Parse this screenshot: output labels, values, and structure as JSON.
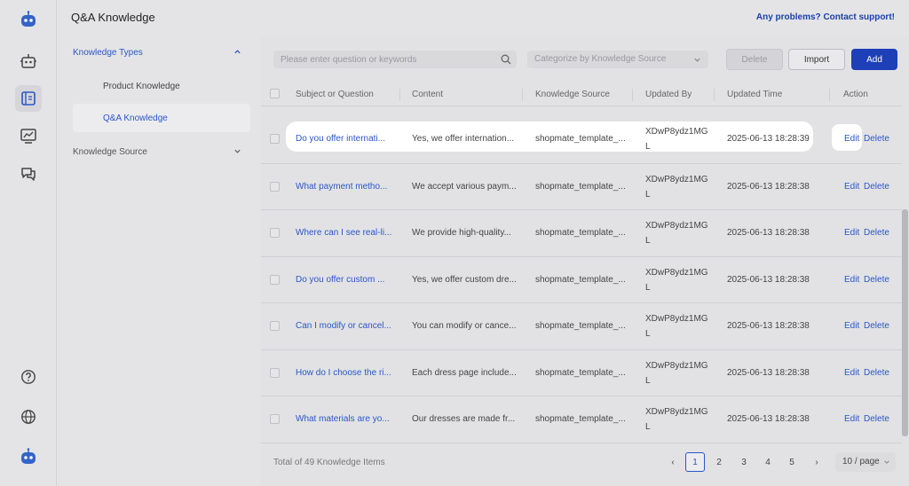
{
  "header": {
    "title": "Q&A Knowledge",
    "support_link": "Any problems? Contact support!"
  },
  "rail": {
    "icons": [
      "robot-logo-icon",
      "bot-icon",
      "knowledge-book-icon",
      "analytics-icon",
      "chat-icon",
      "help-icon",
      "globe-icon",
      "robot-avatar-icon"
    ]
  },
  "nav": {
    "group_types": "Knowledge Types",
    "item_product": "Product Knowledge",
    "item_qa": "Q&A Knowledge",
    "group_source": "Knowledge Source"
  },
  "toolbar": {
    "search_placeholder": "Please enter question or keywords",
    "category_placeholder": "Categorize by Knowledge Source",
    "delete_label": "Delete",
    "import_label": "Import",
    "add_label": "Add"
  },
  "table": {
    "columns": [
      "Subject or Question",
      "Content",
      "Knowledge Source",
      "Updated By",
      "Updated Time",
      "Action"
    ],
    "rows": [
      {
        "subject": "Do you offer internati...",
        "content": "Yes, we offer internation...",
        "source": "shopmate_template_...",
        "updated_by_1": "XDwP8ydz1MG",
        "updated_by_2": "L",
        "time": "2025-06-13 18:28:39",
        "edit": "Edit",
        "delete": "Delete"
      },
      {
        "subject": "What payment metho...",
        "content": "We accept various paym...",
        "source": "shopmate_template_...",
        "updated_by_1": "XDwP8ydz1MG",
        "updated_by_2": "L",
        "time": "2025-06-13 18:28:38",
        "edit": "Edit",
        "delete": "Delete"
      },
      {
        "subject": "Where can I see real-li...",
        "content": "We provide high-quality...",
        "source": "shopmate_template_...",
        "updated_by_1": "XDwP8ydz1MG",
        "updated_by_2": "L",
        "time": "2025-06-13 18:28:38",
        "edit": "Edit",
        "delete": "Delete"
      },
      {
        "subject": " Do you offer custom ...",
        "content": "Yes, we offer custom dre...",
        "source": "shopmate_template_...",
        "updated_by_1": "XDwP8ydz1MG",
        "updated_by_2": "L",
        "time": "2025-06-13 18:28:38",
        "edit": "Edit",
        "delete": "Delete"
      },
      {
        "subject": "Can I modify or cancel...",
        "content": "You can modify or cance...",
        "source": "shopmate_template_...",
        "updated_by_1": "XDwP8ydz1MG",
        "updated_by_2": "L",
        "time": "2025-06-13 18:28:38",
        "edit": "Edit",
        "delete": "Delete"
      },
      {
        "subject": "How do I choose the ri...",
        "content": "Each dress page include...",
        "source": "shopmate_template_...",
        "updated_by_1": "XDwP8ydz1MG",
        "updated_by_2": "L",
        "time": "2025-06-13 18:28:38",
        "edit": "Edit",
        "delete": "Delete"
      },
      {
        "subject": "What materials are yo...",
        "content": "Our dresses are made fr...",
        "source": "shopmate_template_...",
        "updated_by_1": "XDwP8ydz1MG",
        "updated_by_2": "L",
        "time": "2025-06-13 18:28:38",
        "edit": "Edit",
        "delete": "Delete"
      }
    ]
  },
  "footer": {
    "total": "Total of 49 Knowledge Items",
    "pages": [
      "1",
      "2",
      "3",
      "4",
      "5"
    ],
    "current_page": "1",
    "prev": "‹",
    "next": "›",
    "per_page": "10 / page"
  },
  "colors": {
    "accent": "#2a56c6",
    "primary_button": "#1d3fb8",
    "support_link": "#1a3fae"
  }
}
